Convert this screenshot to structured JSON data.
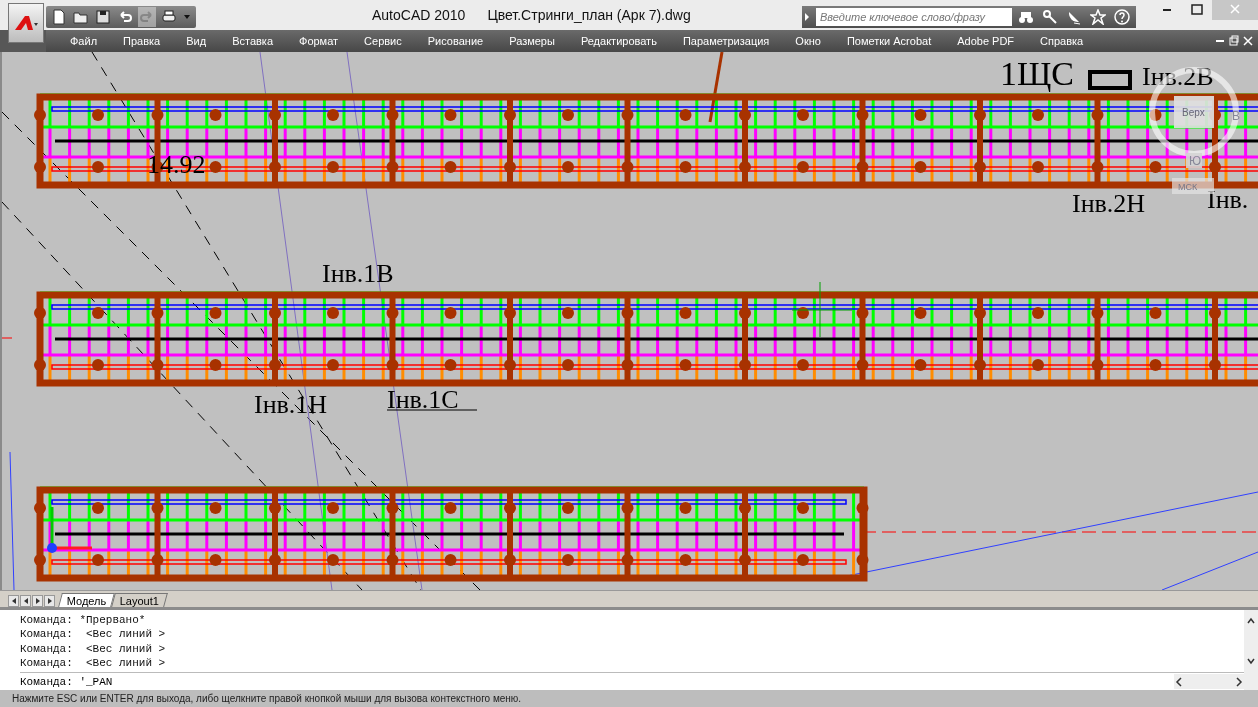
{
  "title_bar": {
    "app": "AutoCAD 2010",
    "document": "Цвет.Стринги_план (Арк 7).dwg"
  },
  "quick_access": {
    "redo_disabled": true
  },
  "search": {
    "placeholder": "Введите ключевое слово/фразу"
  },
  "menu": [
    "Файл",
    "Правка",
    "Вид",
    "Вставка",
    "Формат",
    "Сервис",
    "Рисование",
    "Размеры",
    "Редактировать",
    "Параметризация",
    "Окно",
    "Пометки Acrobat",
    "Adobe PDF",
    "Справка"
  ],
  "drawing": {
    "labels": [
      "1ЩС",
      "Iнв.2В",
      "Iнв.2Н",
      "Iнв.",
      "14.92",
      "Iнв.1В",
      "Iнв.1Н",
      "Iнв.1С"
    ]
  },
  "viewcube": {
    "top": "Верх",
    "east": "В",
    "south": "Ю",
    "ucs": "МСК"
  },
  "layout_tabs": [
    {
      "label": "Модель",
      "selected": true
    },
    {
      "label": "Layout1",
      "selected": false
    }
  ],
  "command_history": [
    "Команда: *Прервано*",
    "Команда:  <Вес линий >",
    "Команда:  <Вес линий >",
    "Команда:  <Вес линий >"
  ],
  "command_line": "Команда: '_PAN",
  "status_bar": "Нажмите ESC или ENTER для выхода, либо щелкните правой кнопкой мыши для вызова контекстного меню."
}
